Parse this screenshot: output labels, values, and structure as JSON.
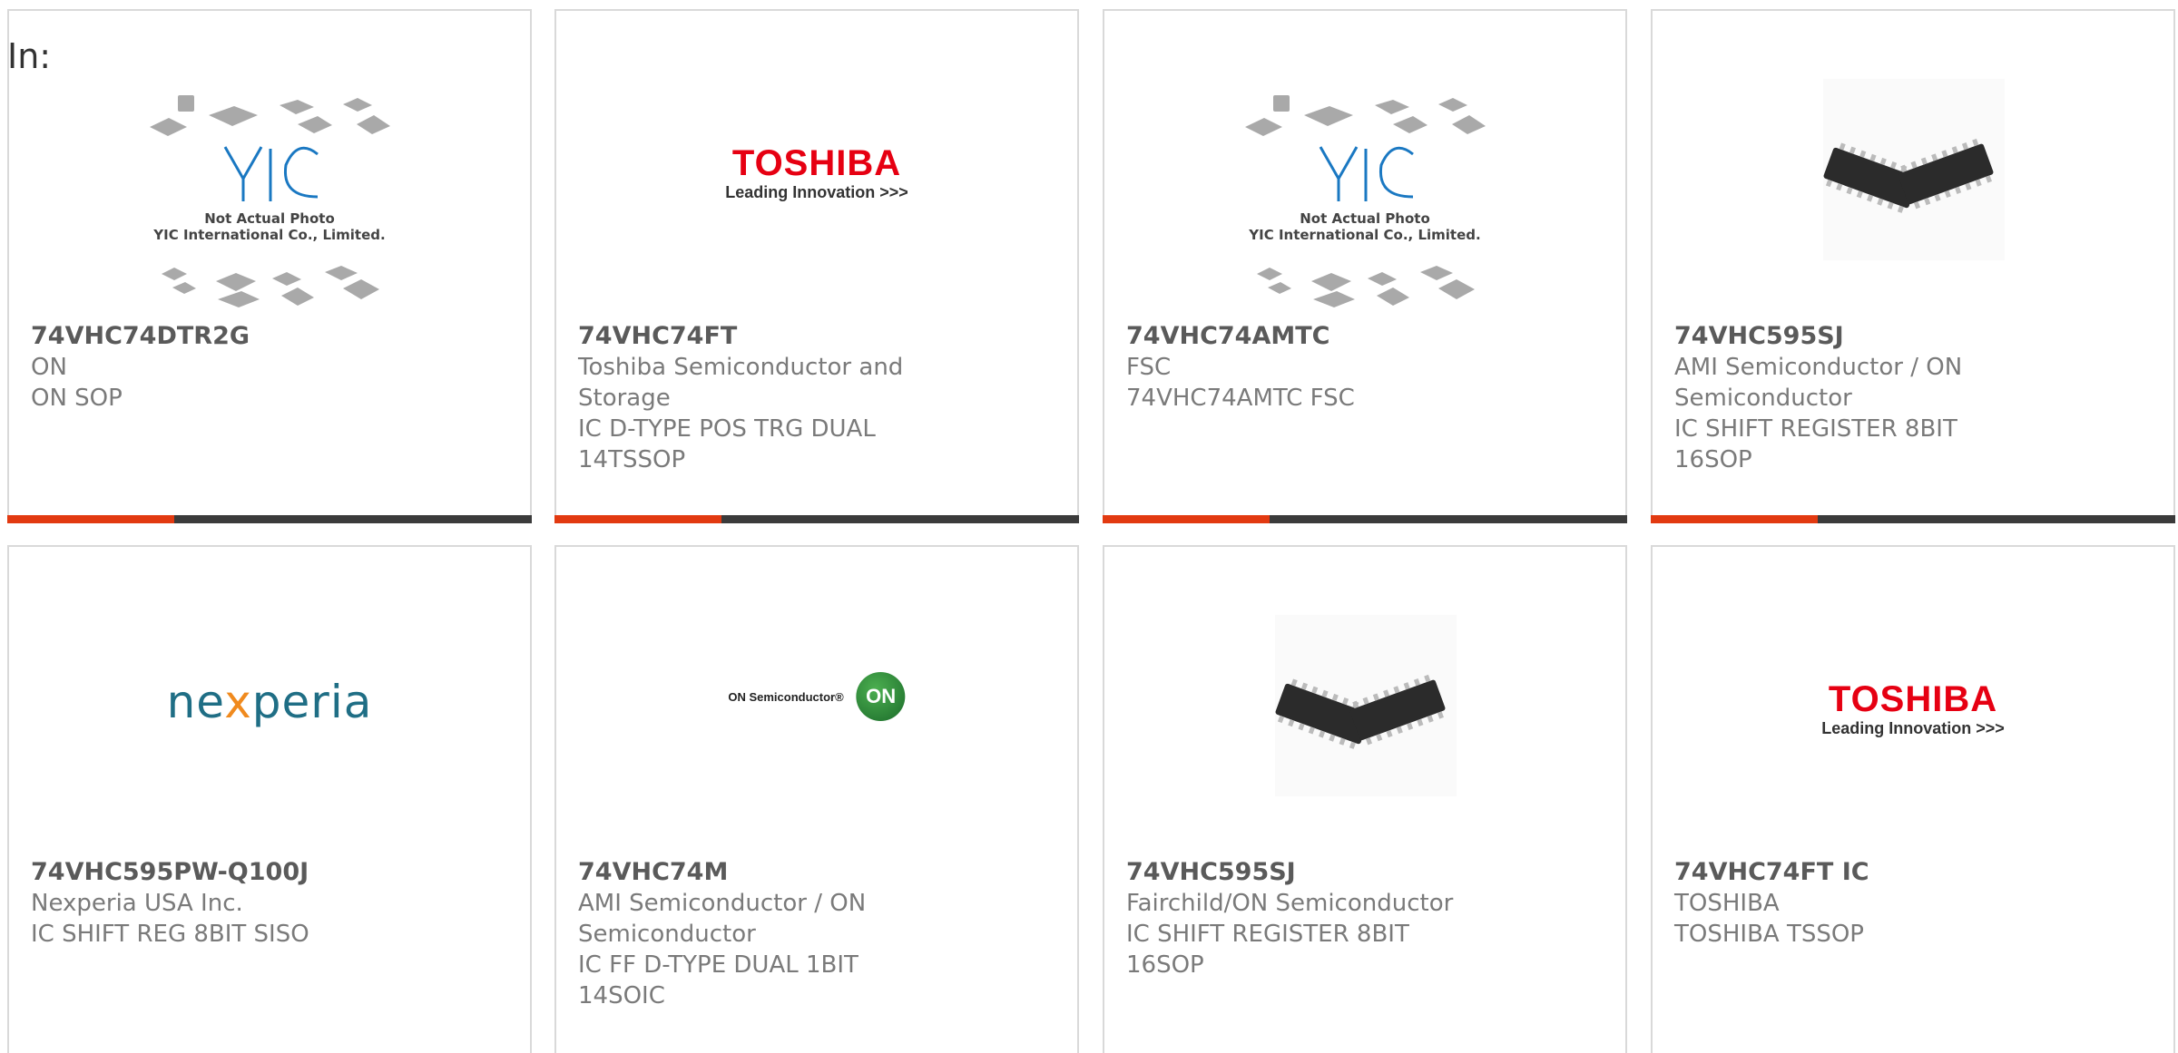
{
  "page": {
    "prefix_text": "In:"
  },
  "colors": {
    "accent": "#e23a11",
    "bar": "#3b3b3b",
    "border": "#d9d9d9",
    "text": "#7a7a7a",
    "title": "#5a5a5a"
  },
  "cards": [
    {
      "part_number": "74VHC74DTR2G",
      "manufacturer": "ON",
      "description": "ON SOP",
      "image": "yic-not-actual-photo",
      "image_caption_line1": "Not Actual Photo",
      "image_caption_line2": "YIC International Co., Limited."
    },
    {
      "part_number": "74VHC74FT",
      "manufacturer": "Toshiba Semiconductor and Storage",
      "description": "IC D-TYPE POS TRG DUAL 14TSSOP",
      "image": "toshiba-logo",
      "logo_brand": "TOSHIBA",
      "logo_tag": "Leading Innovation >>>"
    },
    {
      "part_number": "74VHC74AMTC",
      "manufacturer": "FSC",
      "description": "74VHC74AMTC FSC",
      "image": "yic-not-actual-photo",
      "image_caption_line1": "Not Actual Photo",
      "image_caption_line2": "YIC International Co., Limited."
    },
    {
      "part_number": "74VHC595SJ",
      "manufacturer": "AMI Semiconductor / ON Semiconductor",
      "description": "IC SHIFT REGISTER 8BIT 16SOP",
      "image": "soic-chip-photo"
    },
    {
      "part_number": "74VHC595PW-Q100J",
      "manufacturer": "Nexperia USA Inc.",
      "description": "IC SHIFT REG 8BIT SISO",
      "image": "nexperia-logo",
      "logo_text_a": "ne",
      "logo_text_x": "x",
      "logo_text_b": "peria"
    },
    {
      "part_number": "74VHC74M",
      "manufacturer": "AMI Semiconductor / ON Semiconductor",
      "description": "IC FF D-TYPE DUAL 1BIT 14SOIC",
      "image": "on-semiconductor-logo",
      "logo_wordmark": "ON Semiconductor®",
      "logo_circle": "ON"
    },
    {
      "part_number": "74VHC595SJ",
      "manufacturer": "Fairchild/ON Semiconductor",
      "description": "IC SHIFT REGISTER 8BIT 16SOP",
      "image": "soic-chip-photo"
    },
    {
      "part_number": "74VHC74FT IC",
      "manufacturer": "TOSHIBA",
      "description": "TOSHIBA TSSOP",
      "image": "toshiba-logo",
      "logo_brand": "TOSHIBA",
      "logo_tag": "Leading Innovation >>>"
    }
  ]
}
